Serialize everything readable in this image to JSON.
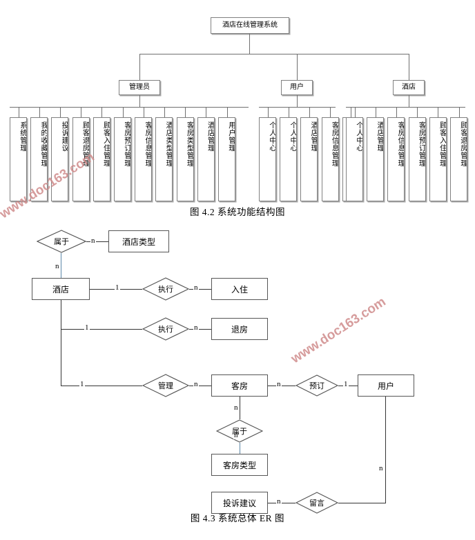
{
  "page": {
    "watermark": "www.doc163.com",
    "line_color": "#808080",
    "er_line_color": "#333333",
    "er_blue_line_color": "#5b87a8",
    "watermark_color": "#d08b8b"
  },
  "figure1": {
    "caption": "图 4.2 系统功能结构图",
    "root": "酒店在线管理系统",
    "branches": [
      {
        "label": "管理员",
        "children": [
          "系统管理",
          "我的收藏管理",
          "投诉建议",
          "顾客退房管理",
          "顾客入住管理",
          "客房预订管理",
          "客房信息管理",
          "酒店类型管理",
          "客房类型管理",
          "酒店管理",
          "用户管理"
        ]
      },
      {
        "label": "用户",
        "children": [
          "个人中心",
          "个人中心",
          "酒店管理",
          "客房信息管理"
        ]
      },
      {
        "label": "酒店",
        "children": [
          "客房预订管理",
          "个人中心",
          "酒店管理",
          "客房信息管理",
          "客房预订管理"
        ]
      }
    ],
    "leaves_in_order": [
      "系统管理",
      "我的收藏管理",
      "投诉建议",
      "顾客退房管理",
      "顾客入住管理",
      "客房预订管理",
      "客房信息管理",
      "酒店类型管理",
      "客房类型管理",
      "酒店管理",
      "用户管理",
      "个人中心",
      "个人中心",
      "酒店管理",
      "客房信息管理",
      "客房预订管理",
      "个人中心",
      "酒店管理",
      "客房信息管理",
      "客房预订管理",
      "顾客入住管理",
      "顾客退房管理"
    ]
  },
  "figure2": {
    "caption": "图 4.3 系统总体 ER 图",
    "entities": {
      "hotel": "酒店",
      "hotel_type": "酒店类型",
      "checkin": "入住",
      "checkout": "退房",
      "room": "客房",
      "user": "用户",
      "room_type": "客房类型",
      "complaint": "投诉建议"
    },
    "relations": {
      "belong_top": "属于",
      "exec_in": "执行",
      "exec_out": "执行",
      "manage": "管理",
      "reserve": "预订",
      "belong_room": "属于",
      "message": "留言"
    },
    "cardinality": {
      "belong_top_to_type": "n",
      "belong_top_to_hotel": "n",
      "hotel_to_exec_in": "1",
      "exec_in_to_checkin": "n",
      "hotel_to_exec_out": "1",
      "exec_out_to_checkout": "n",
      "hotel_to_manage": "1",
      "manage_to_room": "n",
      "room_to_reserve": "n",
      "reserve_to_user": "1",
      "room_to_belong": "n",
      "belong_to_roomtype": "n",
      "complaint_to_message": "n",
      "user_to_message": "n"
    }
  }
}
